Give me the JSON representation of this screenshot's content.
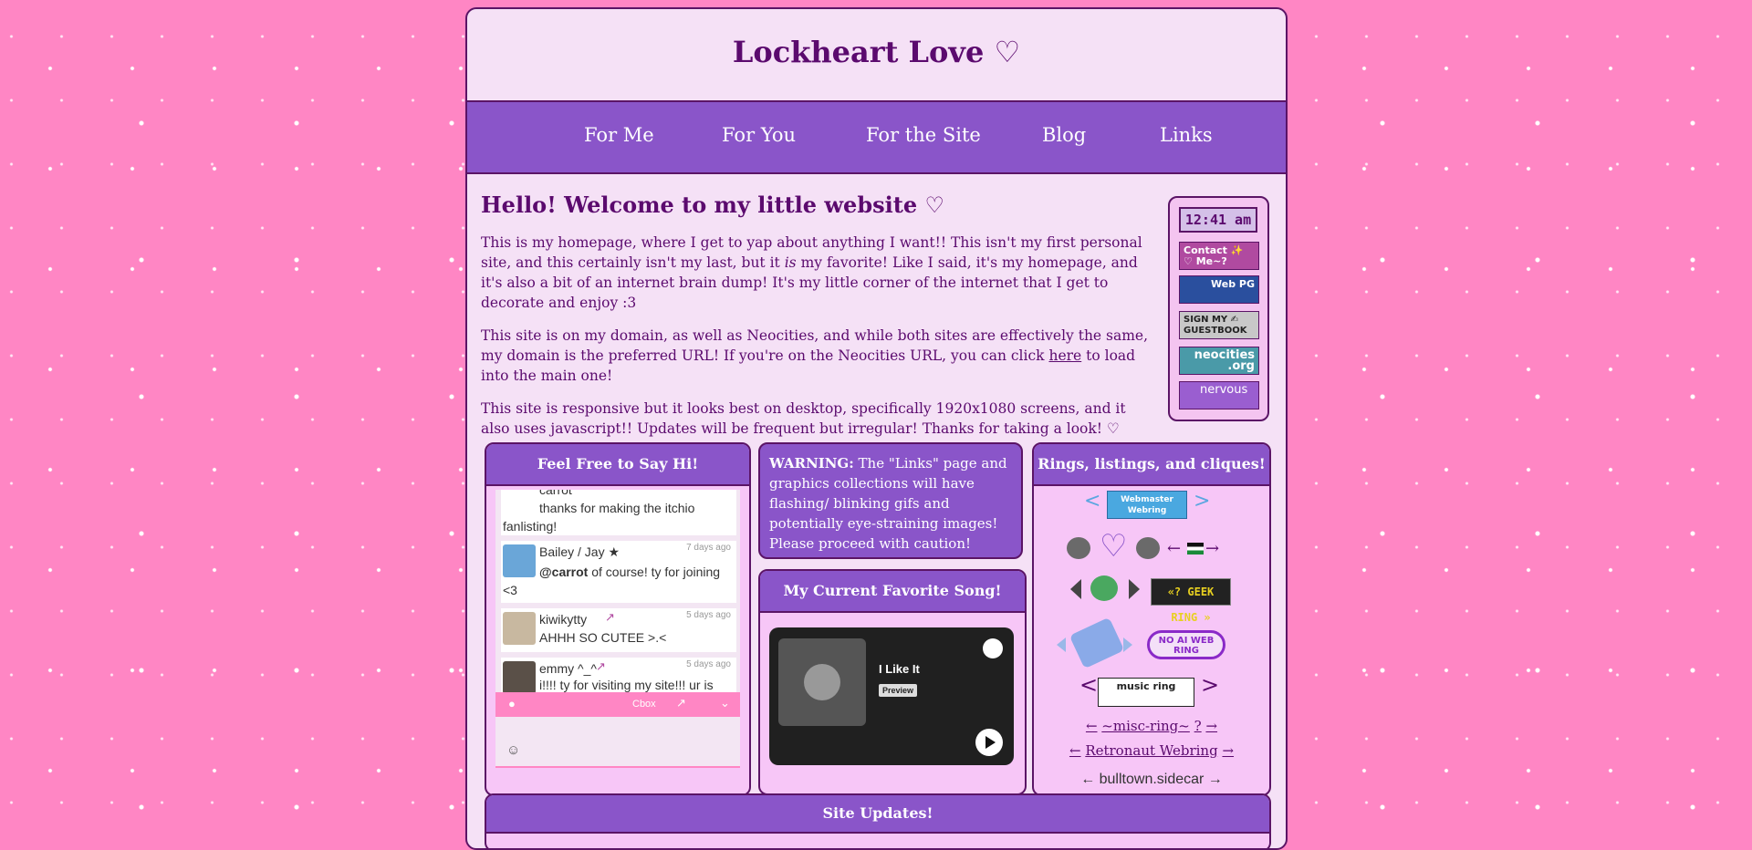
{
  "site": {
    "title": "Lockheart Love ♡"
  },
  "nav": {
    "items": [
      "For Me",
      "For You",
      "For the Site",
      "Blog",
      "Links"
    ]
  },
  "welcome": {
    "heading": "Hello! Welcome to my little website ♡",
    "p1_a": "This is my homepage, where I get to yap about anything I want!! This isn't my first personal site, and this certainly isn't my last, but it ",
    "p1_em": "is",
    "p1_b": " my favorite! Like I said, it's my homepage, and it's also a bit of an internet brain dump! It's my little corner of the internet that I get to decorate and enjoy :3",
    "p2_a": "This site is on my domain, as well as Neocities, and while both sites are effectively the same, my domain is the preferred URL! If you're on the Neocities URL, you can click ",
    "p2_link": "here",
    "p2_b": " to load into the main one!",
    "p3": "This site is responsive but it looks best on desktop, specifically 1920x1080 screens, and it also uses javascript!! Updates will be frequent but irregular! Thanks for taking a look! ♡"
  },
  "sidebar": {
    "clock": "12:41 am",
    "buttons": [
      "Contact ✨ ♡ Me~?",
      "Web PG",
      "SIGN MY ✍ GUESTBOOK",
      "neocities .org",
      "nervous"
    ]
  },
  "cbox": {
    "title": "Feel Free to Say Hi!",
    "partial": "carrot",
    "first_msg": "thanks for making the itchio fanlisting!",
    "messages": [
      {
        "name": "Bailey / Jay ★",
        "time": "7 days ago",
        "mention": "@carrot",
        "text": " of course! ty for joining <3"
      },
      {
        "name": "kiwikytty",
        "time": "5 days ago",
        "text": "AHHH SO CUTEE >.<"
      },
      {
        "name": "emmy ^_^",
        "time": "5 days ago",
        "text": "i!!!! ty for visiting my site!!! ur is"
      }
    ],
    "bar_label": "Cbox",
    "emoji": "☺"
  },
  "warning": {
    "bold": "WARNING:",
    "text": " The \"Links\" page and graphics collections will have flashing/ blinking gifs and potentially eye-straining images! Please proceed with caution!"
  },
  "song": {
    "title": "My Current Favorite Song!",
    "track": "I Like It",
    "preview": "Preview"
  },
  "rings": {
    "title": "Rings, listings, and cliques!",
    "webmaster": "Webmaster Webring",
    "geek": "«? GEEK RING »",
    "noai": "NO AI WEB RING",
    "music": "music ring",
    "misc_prev": "←",
    "misc": "~misc-ring~",
    "misc_q": "?",
    "misc_next": "→",
    "retro_prev": "←",
    "retro": "Retronaut Webring",
    "retro_next": "→",
    "bulltown": "← bulltown.sidecar →"
  },
  "updates": {
    "title": "Site Updates!"
  },
  "colors": {
    "accent": "#8a55c9",
    "pink": "#ff86c4",
    "dark": "#5b0a6e",
    "panel": "#f7c6f7"
  }
}
